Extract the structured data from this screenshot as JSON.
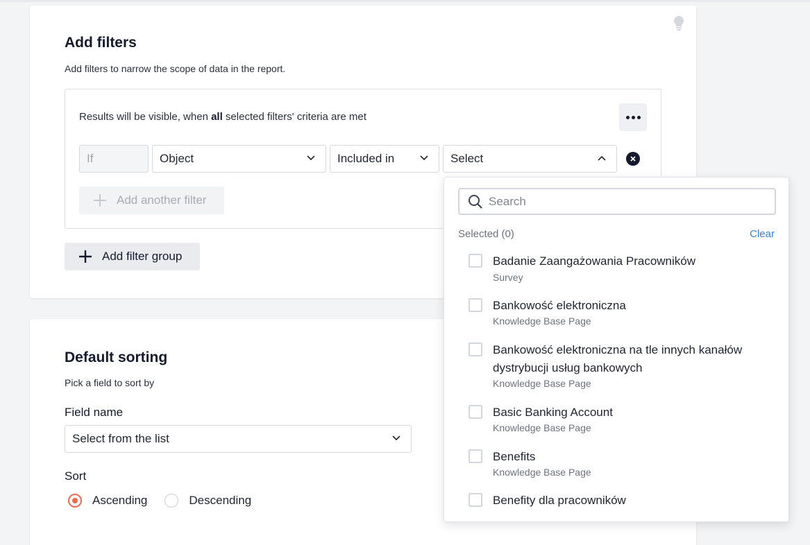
{
  "filters_card": {
    "title": "Add filters",
    "description": "Add filters to narrow the scope of data in the report.",
    "group_note_prefix": "Results will be visible, when ",
    "group_note_bold": "all",
    "group_note_suffix": " selected filters' criteria are met",
    "if_label": "If",
    "object_value": "Object",
    "operator_value": "Included in",
    "select_value": "Select",
    "add_another_label": "Add another filter",
    "add_group_label": "Add filter group"
  },
  "sorting_card": {
    "title": "Default sorting",
    "description": "Pick a field to sort by",
    "field_label": "Field name",
    "field_placeholder": "Select from the list",
    "sort_label": "Sort",
    "ascending_label": "Ascending",
    "descending_label": "Descending",
    "selected_sort": "Ascending"
  },
  "dropdown": {
    "search_placeholder": "Search",
    "selected_label": "Selected (0)",
    "clear_label": "Clear",
    "items": [
      {
        "title": "Badanie Zaangażowania Pracowników",
        "type": "Survey"
      },
      {
        "title": "Bankowość elektroniczna",
        "type": "Knowledge Base Page"
      },
      {
        "title": "Bankowość elektroniczna na tle innych kanałów dystrybucji usług bankowych",
        "type": "Knowledge Base Page"
      },
      {
        "title": "Basic Banking Account",
        "type": "Knowledge Base Page"
      },
      {
        "title": "Benefits",
        "type": "Knowledge Base Page"
      },
      {
        "title": "Benefity dla pracowników",
        "type": ""
      }
    ]
  },
  "colors": {
    "accent": "#ef6a4c",
    "link": "#3b82d6",
    "text_dark": "#151a2d"
  }
}
